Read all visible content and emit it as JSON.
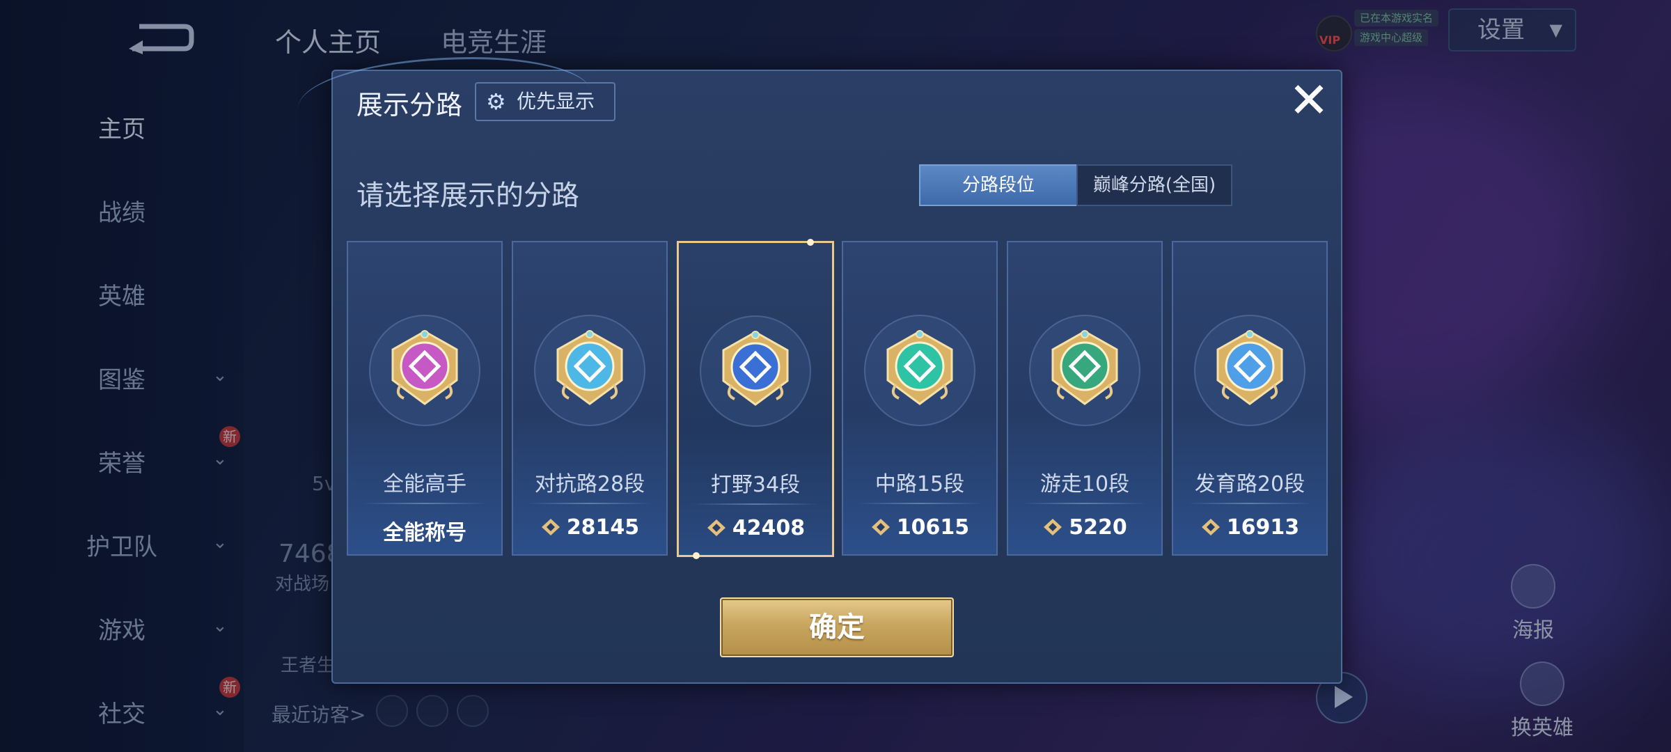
{
  "sidebar": {
    "items": [
      {
        "label": "主页",
        "active": true
      },
      {
        "label": "战绩"
      },
      {
        "label": "英雄"
      },
      {
        "label": "图鉴"
      },
      {
        "label": "荣誉"
      },
      {
        "label": "护卫队"
      },
      {
        "label": "游戏"
      },
      {
        "label": "社交"
      }
    ],
    "new_badge": "新"
  },
  "header": {
    "tabs": [
      "个人主页",
      "电竞生涯"
    ],
    "settings_label": "设置",
    "vip_label": "VIP",
    "status_chips": [
      "已在本游戏实名",
      "游戏中心超级"
    ]
  },
  "background": {
    "stat_value": "7468",
    "stat_label": "对战场",
    "side_text": "王者生",
    "small_text": "5v",
    "recent_visitors": "最近访客>",
    "right_buttons": [
      "海报",
      "换英雄"
    ]
  },
  "modal": {
    "title": "展示分路",
    "priority_button": "优先显示",
    "subtitle": "请选择展示的分路",
    "segments": [
      "分路段位",
      "巅峰分路(全国)"
    ],
    "active_segment": 0,
    "confirm": "确定",
    "cards": [
      {
        "label": "全能高手",
        "value": "全能称号",
        "has_points": false,
        "color": "#c659c4",
        "selected": false
      },
      {
        "label": "对抗路28段",
        "value": "28145",
        "has_points": true,
        "color": "#4db8e6",
        "selected": false
      },
      {
        "label": "打野34段",
        "value": "42408",
        "has_points": true,
        "color": "#3a6fd6",
        "selected": true
      },
      {
        "label": "中路15段",
        "value": "10615",
        "has_points": true,
        "color": "#2fc3a6",
        "selected": false
      },
      {
        "label": "游走10段",
        "value": "5220",
        "has_points": true,
        "color": "#37a77e",
        "selected": false
      },
      {
        "label": "发育路20段",
        "value": "16913",
        "has_points": true,
        "color": "#4f9fe8",
        "selected": false
      }
    ]
  },
  "colors": {
    "accent_gold": "#e9c98c",
    "segment_active": "#4e7bbb"
  }
}
